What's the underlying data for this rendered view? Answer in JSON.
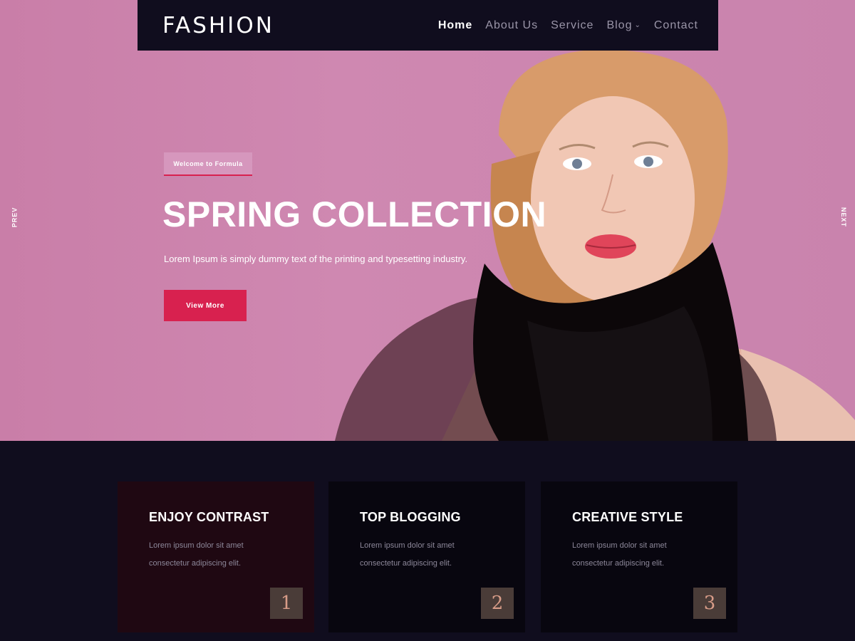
{
  "header": {
    "logo": "FASHION",
    "menu": [
      {
        "label": "Home",
        "active": true
      },
      {
        "label": "About Us",
        "active": false
      },
      {
        "label": "Service",
        "active": false
      },
      {
        "label": "Blog",
        "active": false,
        "has_dropdown": true
      },
      {
        "label": "Contact",
        "active": false
      }
    ]
  },
  "slider": {
    "prev_label": "PREV",
    "next_label": "NEXT",
    "badge": "Welcome to Formula",
    "title": "SPRING COLLECTION",
    "description": "Lorem Ipsum is simply dummy text of the printing and typesetting industry.",
    "button": "View More"
  },
  "features": [
    {
      "title": "ENJOY CONTRAST",
      "text": "Lorem ipsum dolor sit amet consectetur adipiscing elit.",
      "number": "1"
    },
    {
      "title": "TOP BLOGGING",
      "text": "Lorem ipsum dolor sit amet consectetur adipiscing elit.",
      "number": "2"
    },
    {
      "title": "CREATIVE STYLE",
      "text": "Lorem ipsum dolor sit amet consectetur adipiscing elit.",
      "number": "3"
    }
  ],
  "colors": {
    "accent": "#d8214f",
    "dark": "#100d1e",
    "hero_bg": "#cf88b1",
    "card1_bg": "#1f0812",
    "card_bg": "#08060f",
    "number_bg": "#4a3c38"
  },
  "icons": {
    "blog_dropdown": "chevron-down-icon"
  }
}
